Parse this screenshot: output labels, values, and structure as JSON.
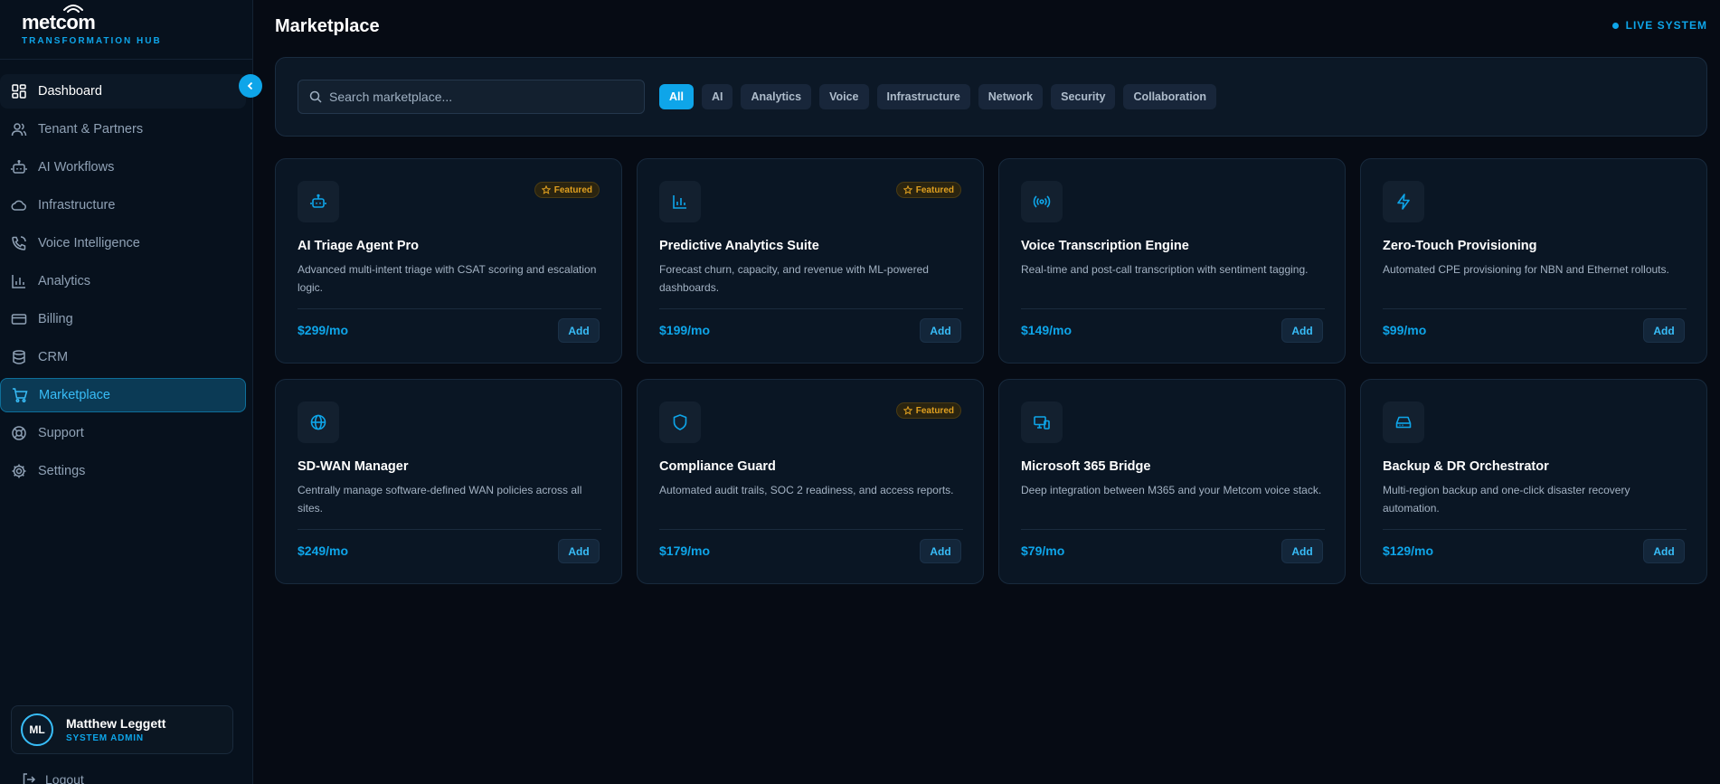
{
  "brand": {
    "name": "metcom",
    "subtitle": "TRANSFORMATION HUB"
  },
  "sidebar": {
    "items": [
      {
        "label": "Dashboard",
        "icon": "grid-icon"
      },
      {
        "label": "Tenant & Partners",
        "icon": "users-icon"
      },
      {
        "label": "AI Workflows",
        "icon": "bot-icon"
      },
      {
        "label": "Infrastructure",
        "icon": "cloud-icon"
      },
      {
        "label": "Voice Intelligence",
        "icon": "phone-icon"
      },
      {
        "label": "Analytics",
        "icon": "bar-chart-icon"
      },
      {
        "label": "Billing",
        "icon": "credit-card-icon"
      },
      {
        "label": "CRM",
        "icon": "database-icon"
      },
      {
        "label": "Marketplace",
        "icon": "cart-icon"
      },
      {
        "label": "Support",
        "icon": "lifebuoy-icon"
      },
      {
        "label": "Settings",
        "icon": "gear-icon"
      }
    ],
    "active": "Marketplace"
  },
  "user": {
    "initials": "ML",
    "name": "Matthew Leggett",
    "role": "SYSTEM ADMIN"
  },
  "logout_label": "Logout",
  "header": {
    "title": "Marketplace",
    "status": "LIVE SYSTEM"
  },
  "search": {
    "placeholder": "Search marketplace..."
  },
  "filters": [
    "All",
    "AI",
    "Analytics",
    "Voice",
    "Infrastructure",
    "Network",
    "Security",
    "Collaboration"
  ],
  "active_filter": "All",
  "featured_label": "Featured",
  "add_label": "Add",
  "colors": {
    "accent": "#0ea5e9",
    "featured": "#e0a020",
    "background": "#060b14"
  },
  "products": [
    {
      "title": "AI Triage Agent Pro",
      "desc": "Advanced multi-intent triage with CSAT scoring and escalation logic.",
      "price": "$299/mo",
      "featured": true,
      "icon": "bot-icon"
    },
    {
      "title": "Predictive Analytics Suite",
      "desc": "Forecast churn, capacity, and revenue with ML-powered dashboards.",
      "price": "$199/mo",
      "featured": true,
      "icon": "bar-chart-icon"
    },
    {
      "title": "Voice Transcription Engine",
      "desc": "Real-time and post-call transcription with sentiment tagging.",
      "price": "$149/mo",
      "featured": false,
      "icon": "radio-icon"
    },
    {
      "title": "Zero-Touch Provisioning",
      "desc": "Automated CPE provisioning for NBN and Ethernet rollouts.",
      "price": "$99/mo",
      "featured": false,
      "icon": "lightning-icon"
    },
    {
      "title": "SD-WAN Manager",
      "desc": "Centrally manage software-defined WAN policies across all sites.",
      "price": "$249/mo",
      "featured": false,
      "icon": "globe-icon"
    },
    {
      "title": "Compliance Guard",
      "desc": "Automated audit trails, SOC 2 readiness, and access reports.",
      "price": "$179/mo",
      "featured": true,
      "icon": "shield-icon"
    },
    {
      "title": "Microsoft 365 Bridge",
      "desc": "Deep integration between M365 and your Metcom voice stack.",
      "price": "$79/mo",
      "featured": false,
      "icon": "devices-icon"
    },
    {
      "title": "Backup & DR Orchestrator",
      "desc": "Multi-region backup and one-click disaster recovery automation.",
      "price": "$129/mo",
      "featured": false,
      "icon": "hard-drive-icon"
    }
  ]
}
